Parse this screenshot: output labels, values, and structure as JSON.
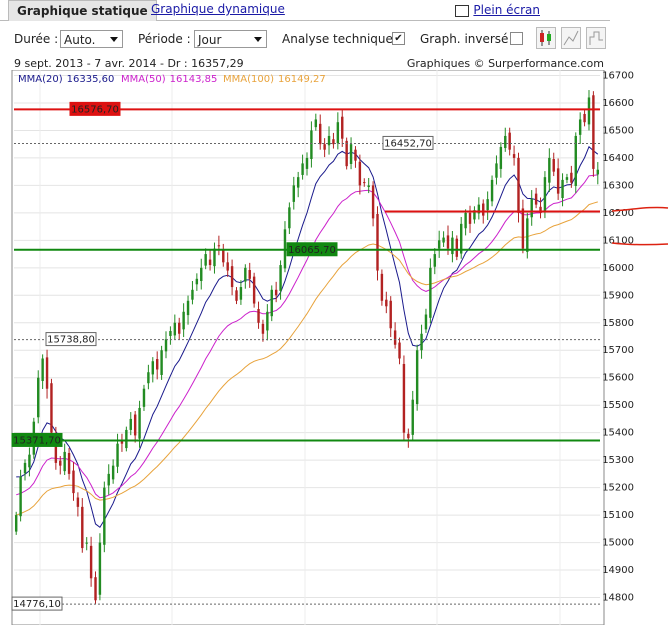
{
  "tabs": {
    "active": "Graphique statique",
    "other": "Graphique dynamique",
    "fullscreen": "Plein écran"
  },
  "controls": {
    "duree_label": "Durée :",
    "duree_value": "Auto.",
    "periode_label": "Période :",
    "periode_value": "Jour",
    "analyse_label": "Analyse technique :",
    "analyse_checked": "✔",
    "inverse_label": "Graph. inversé :"
  },
  "header": {
    "range": "9 sept. 2013 - 7 avr. 2014 - Dr : 16357,29",
    "source": "Graphiques © Surperformance.com"
  },
  "colors": {
    "up": "#228b22",
    "down": "#b22222",
    "mma20": "#1a1a8c",
    "mma50": "#cc22cc",
    "mma100": "#e8a33c",
    "resistance": "#dd1111",
    "support": "#118811"
  },
  "chart_data": {
    "type": "candlestick",
    "title": "",
    "xlabel": "",
    "ylabel": "",
    "ylim": [
      14700,
      16720
    ],
    "yticks": [
      "14800",
      "14900",
      "15000",
      "15100",
      "15200",
      "15300",
      "15400",
      "15500",
      "15600",
      "15700",
      "15800",
      "15900",
      "16000",
      "16100",
      "16200",
      "16300",
      "16400",
      "16500",
      "16600",
      "16700"
    ],
    "legend": [
      {
        "name": "MMA(20)",
        "value": "16335,60"
      },
      {
        "name": "MMA(50)",
        "value": "16143,85"
      },
      {
        "name": "MMA(100)",
        "value": "16149,27"
      }
    ],
    "levels": [
      {
        "label": "16576,70",
        "value": 16576.7,
        "style": "resistance"
      },
      {
        "label": "16452,70",
        "value": 16452.7,
        "style": "dashed"
      },
      {
        "label": "16065,70",
        "value": 16065.7,
        "style": "support"
      },
      {
        "label": "15738,80",
        "value": 15738.8,
        "style": "dashed"
      },
      {
        "label": "15371,70",
        "value": 15371.7,
        "style": "support"
      },
      {
        "label": "14776,10",
        "value": 14776.1,
        "style": "dashed"
      }
    ],
    "close": [
      15100,
      15240,
      15290,
      15320,
      15440,
      15600,
      15670,
      15560,
      15400,
      15290,
      15280,
      15330,
      15250,
      15180,
      15130,
      14980,
      15000,
      14870,
      14790,
      15000,
      15200,
      15250,
      15280,
      15360,
      15360,
      15410,
      15450,
      15390,
      15490,
      15560,
      15620,
      15660,
      15630,
      15700,
      15740,
      15770,
      15800,
      15760,
      15840,
      15880,
      15920,
      15960,
      16000,
      16050,
      16010,
      16070,
      16080,
      16020,
      15990,
      15930,
      15880,
      15930,
      16000,
      15960,
      15870,
      15800,
      15760,
      15840,
      15920,
      15900,
      16010,
      16140,
      16220,
      16300,
      16330,
      16380,
      16400,
      16500,
      16540,
      16450,
      16430,
      16480,
      16450,
      16530,
      16470,
      16370,
      16450,
      16390,
      16300,
      16310,
      16300,
      16180,
      15990,
      15880,
      15860,
      15780,
      15720,
      15670,
      15400,
      15380,
      15520,
      15700,
      15760,
      15830,
      16000,
      16050,
      16100,
      16110,
      16070,
      16110,
      16040,
      16160,
      16200,
      16160,
      16210,
      16230,
      16190,
      16250,
      16320,
      16380,
      16440,
      16480,
      16430,
      16400,
      16200,
      16070,
      16180,
      16250,
      16230,
      16200,
      16330,
      16400,
      16350,
      16270,
      16320,
      16330,
      16310,
      16480,
      16540,
      16530,
      16620,
      16360,
      16357
    ]
  }
}
